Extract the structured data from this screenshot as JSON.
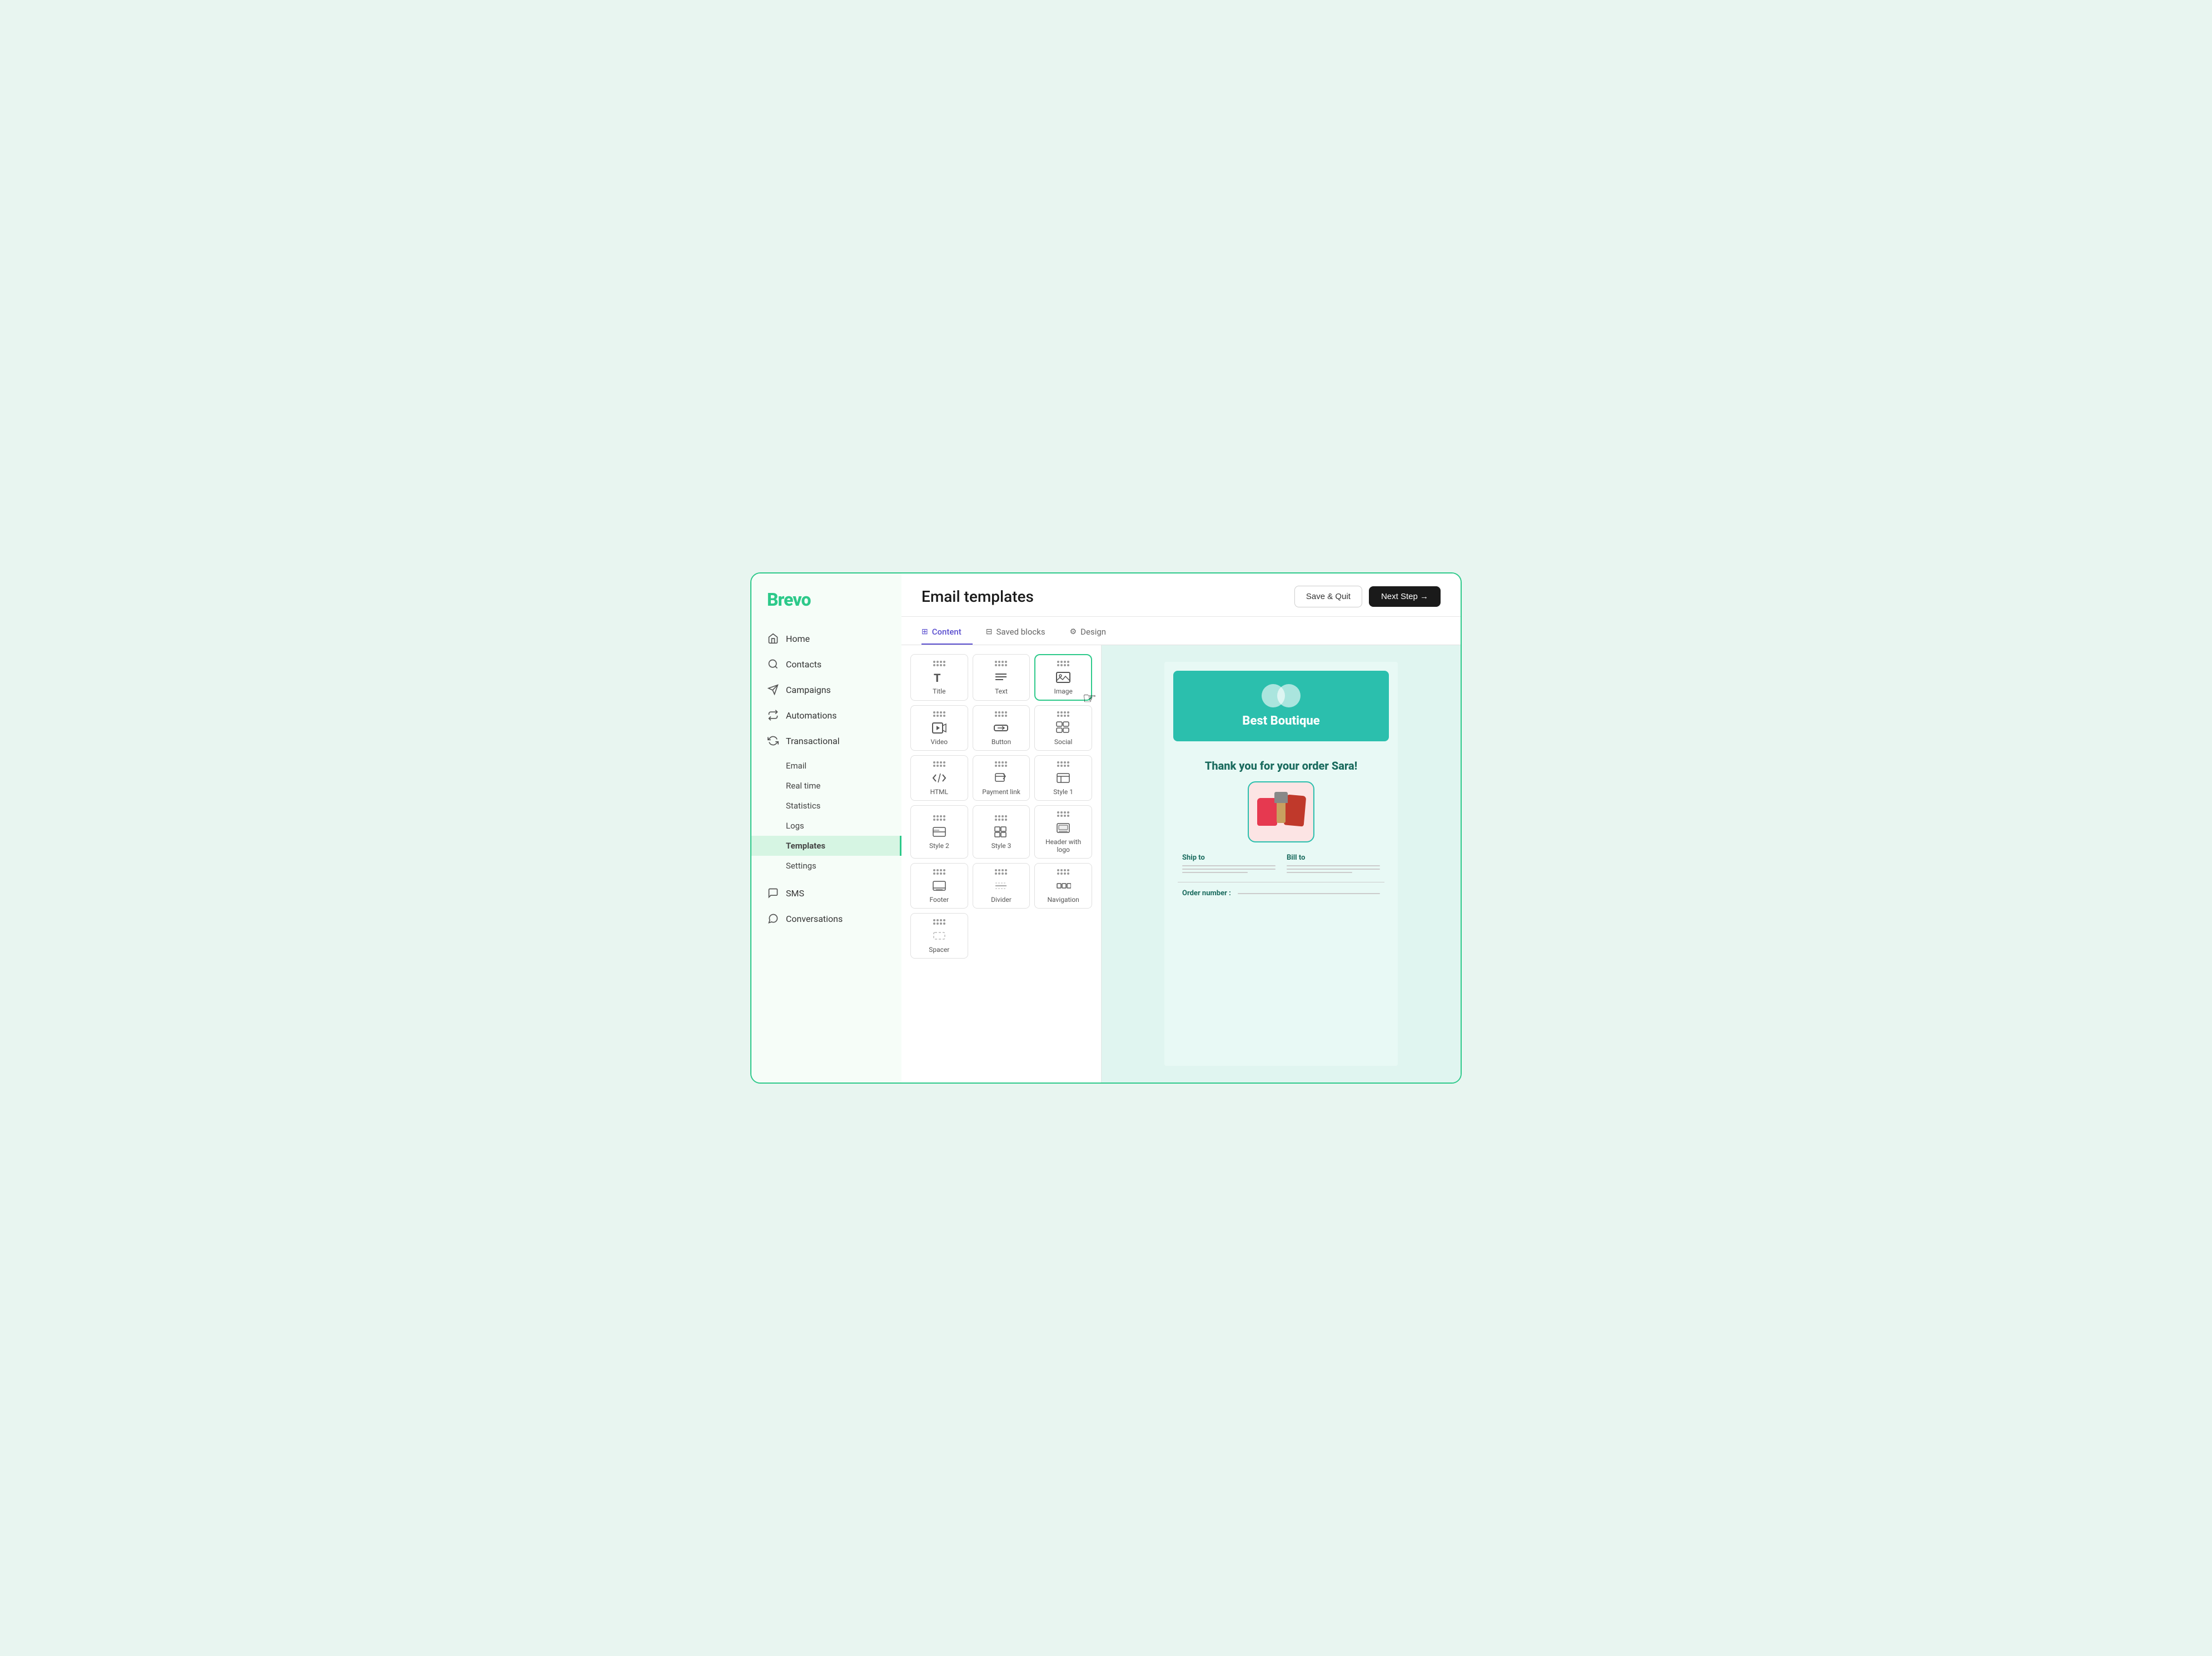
{
  "app": {
    "logo": "Brevo",
    "logo_dot_color": "#2dc98a"
  },
  "sidebar": {
    "nav_items": [
      {
        "id": "home",
        "label": "Home",
        "icon": "home"
      },
      {
        "id": "contacts",
        "label": "Contacts",
        "icon": "contacts"
      },
      {
        "id": "campaigns",
        "label": "Campaigns",
        "icon": "campaigns"
      },
      {
        "id": "automations",
        "label": "Automations",
        "icon": "automations"
      },
      {
        "id": "transactional",
        "label": "Transactional",
        "icon": "transactional",
        "expanded": true
      }
    ],
    "transactional_sub": [
      {
        "id": "email",
        "label": "Email"
      },
      {
        "id": "realtime",
        "label": "Real time"
      },
      {
        "id": "statistics",
        "label": "Statistics"
      },
      {
        "id": "logs",
        "label": "Logs"
      },
      {
        "id": "templates",
        "label": "Templates",
        "active": true
      },
      {
        "id": "settings",
        "label": "Settings"
      }
    ],
    "bottom_items": [
      {
        "id": "sms",
        "label": "SMS",
        "icon": "sms"
      },
      {
        "id": "conversations",
        "label": "Conversations",
        "icon": "conversations"
      }
    ]
  },
  "header": {
    "title": "Email templates",
    "save_quit_label": "Save & Quit",
    "next_step_label": "Next Step →"
  },
  "tabs": [
    {
      "id": "content",
      "label": "Content",
      "icon": "☰",
      "active": true
    },
    {
      "id": "saved_blocks",
      "label": "Saved blocks",
      "icon": "⊞"
    },
    {
      "id": "design",
      "label": "Design",
      "icon": "⚙"
    }
  ],
  "blocks": [
    {
      "id": "title",
      "label": "Title",
      "icon": "title"
    },
    {
      "id": "text",
      "label": "Text",
      "icon": "text"
    },
    {
      "id": "image",
      "label": "Image",
      "icon": "image",
      "selected": true
    },
    {
      "id": "video",
      "label": "Video",
      "icon": "video"
    },
    {
      "id": "button",
      "label": "Button",
      "icon": "button"
    },
    {
      "id": "social",
      "label": "Social",
      "icon": "social"
    },
    {
      "id": "html",
      "label": "HTML",
      "icon": "html"
    },
    {
      "id": "payment_link",
      "label": "Payment link",
      "icon": "payment"
    },
    {
      "id": "style1",
      "label": "Style 1",
      "icon": "style1"
    },
    {
      "id": "style2",
      "label": "Style 2",
      "icon": "style2"
    },
    {
      "id": "style3",
      "label": "Style 3",
      "icon": "style3"
    },
    {
      "id": "header_logo",
      "label": "Header with logo",
      "icon": "header"
    },
    {
      "id": "footer",
      "label": "Footer",
      "icon": "footer"
    },
    {
      "id": "divider",
      "label": "Divider",
      "icon": "divider"
    },
    {
      "id": "navigation",
      "label": "Navigation",
      "icon": "nav"
    },
    {
      "id": "spacer",
      "label": "Spacer",
      "icon": "spacer"
    }
  ],
  "email_preview": {
    "brand": "Best Boutique",
    "thank_you": "Thank you for your order Sara!",
    "ship_to": "Ship to",
    "bill_to": "Bill to",
    "order_number": "Order number :"
  },
  "colors": {
    "teal": "#2bbfad",
    "green": "#2dc98a",
    "dark": "#1a1a1a",
    "purple": "#5b4fcf",
    "text_dark": "#1a6b5e"
  }
}
